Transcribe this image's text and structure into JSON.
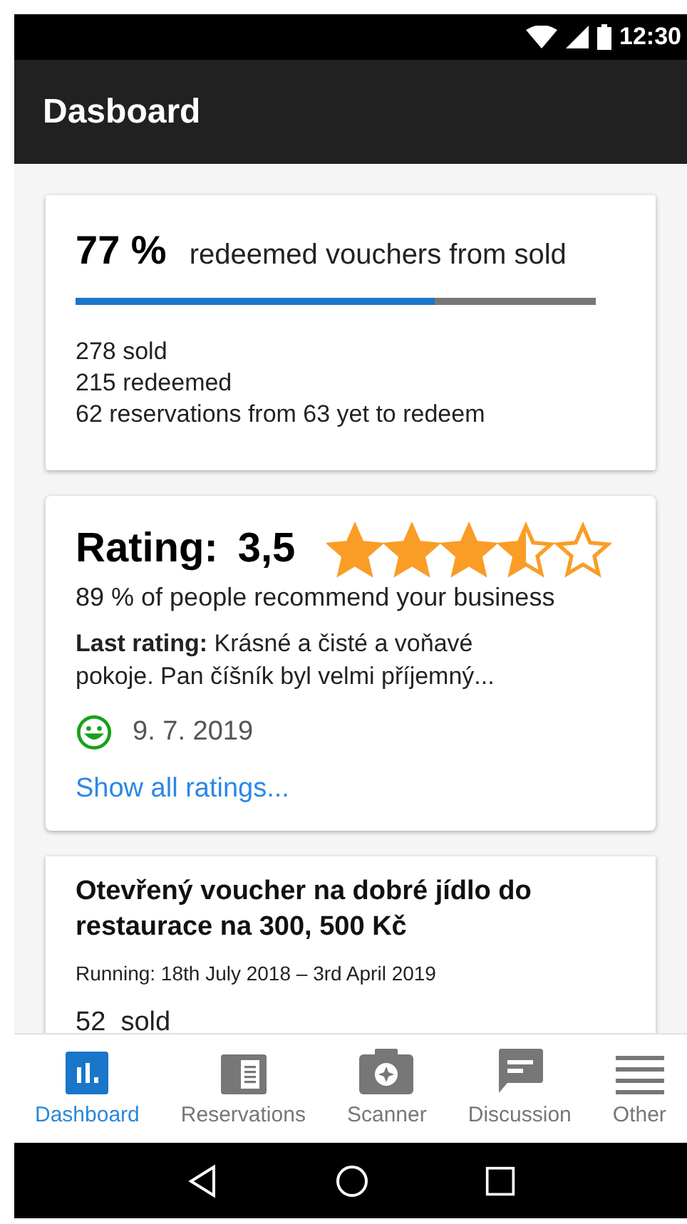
{
  "status_bar": {
    "time": "12:30"
  },
  "app_bar": {
    "title": "Dasboard"
  },
  "redemption_card": {
    "percent": "77 %",
    "caption": "redeemed vouchers from sold",
    "level": 0.69,
    "lines": [
      "278 sold",
      "215 redeemed",
      "62 reservations from 63 yet to redeem"
    ]
  },
  "rating_card": {
    "title": "Rating:",
    "score": "3,5",
    "stars": 3.5,
    "recommend": "89 % of people recommend your business",
    "last_rating": "**Last rating:** Krásné a čisté a voňavé pokoje. Pan číšník byl velmi příjemný...",
    "date": "9. 7. 2019",
    "link": "Show all ratings..."
  },
  "voucher_card": {
    "title": "Otevřený voucher na dobré jídlo do restaurace na 300, 500 Kč",
    "running": "Running: 18th July 2018 – 3rd April 2019",
    "sold": "52  sold"
  },
  "bottom_nav": [
    {
      "label": "Dashboard",
      "selected": true
    },
    {
      "label": "Reservations",
      "selected": false
    },
    {
      "label": "Scanner",
      "selected": false
    },
    {
      "label": "Discussion",
      "selected": false
    },
    {
      "label": "Other",
      "selected": false
    }
  ]
}
